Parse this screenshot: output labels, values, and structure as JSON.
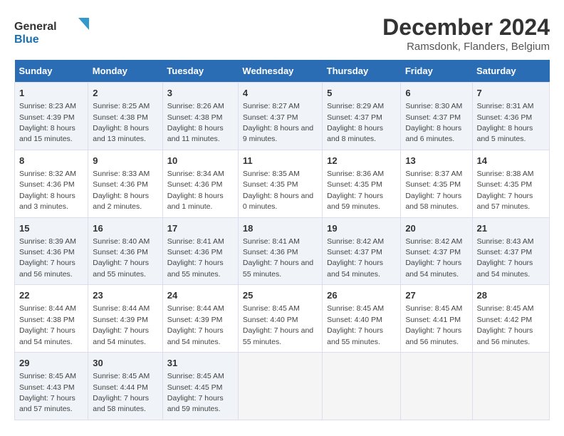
{
  "logo": {
    "line1": "General",
    "line2": "Blue"
  },
  "title": "December 2024",
  "subtitle": "Ramsdonk, Flanders, Belgium",
  "days_of_week": [
    "Sunday",
    "Monday",
    "Tuesday",
    "Wednesday",
    "Thursday",
    "Friday",
    "Saturday"
  ],
  "weeks": [
    [
      {
        "day": "1",
        "sunrise": "8:23 AM",
        "sunset": "4:39 PM",
        "daylight": "8 hours and 15 minutes."
      },
      {
        "day": "2",
        "sunrise": "8:25 AM",
        "sunset": "4:38 PM",
        "daylight": "8 hours and 13 minutes."
      },
      {
        "day": "3",
        "sunrise": "8:26 AM",
        "sunset": "4:38 PM",
        "daylight": "8 hours and 11 minutes."
      },
      {
        "day": "4",
        "sunrise": "8:27 AM",
        "sunset": "4:37 PM",
        "daylight": "8 hours and 9 minutes."
      },
      {
        "day": "5",
        "sunrise": "8:29 AM",
        "sunset": "4:37 PM",
        "daylight": "8 hours and 8 minutes."
      },
      {
        "day": "6",
        "sunrise": "8:30 AM",
        "sunset": "4:37 PM",
        "daylight": "8 hours and 6 minutes."
      },
      {
        "day": "7",
        "sunrise": "8:31 AM",
        "sunset": "4:36 PM",
        "daylight": "8 hours and 5 minutes."
      }
    ],
    [
      {
        "day": "8",
        "sunrise": "8:32 AM",
        "sunset": "4:36 PM",
        "daylight": "8 hours and 3 minutes."
      },
      {
        "day": "9",
        "sunrise": "8:33 AM",
        "sunset": "4:36 PM",
        "daylight": "8 hours and 2 minutes."
      },
      {
        "day": "10",
        "sunrise": "8:34 AM",
        "sunset": "4:36 PM",
        "daylight": "8 hours and 1 minute."
      },
      {
        "day": "11",
        "sunrise": "8:35 AM",
        "sunset": "4:35 PM",
        "daylight": "8 hours and 0 minutes."
      },
      {
        "day": "12",
        "sunrise": "8:36 AM",
        "sunset": "4:35 PM",
        "daylight": "7 hours and 59 minutes."
      },
      {
        "day": "13",
        "sunrise": "8:37 AM",
        "sunset": "4:35 PM",
        "daylight": "7 hours and 58 minutes."
      },
      {
        "day": "14",
        "sunrise": "8:38 AM",
        "sunset": "4:35 PM",
        "daylight": "7 hours and 57 minutes."
      }
    ],
    [
      {
        "day": "15",
        "sunrise": "8:39 AM",
        "sunset": "4:36 PM",
        "daylight": "7 hours and 56 minutes."
      },
      {
        "day": "16",
        "sunrise": "8:40 AM",
        "sunset": "4:36 PM",
        "daylight": "7 hours and 55 minutes."
      },
      {
        "day": "17",
        "sunrise": "8:41 AM",
        "sunset": "4:36 PM",
        "daylight": "7 hours and 55 minutes."
      },
      {
        "day": "18",
        "sunrise": "8:41 AM",
        "sunset": "4:36 PM",
        "daylight": "7 hours and 55 minutes."
      },
      {
        "day": "19",
        "sunrise": "8:42 AM",
        "sunset": "4:37 PM",
        "daylight": "7 hours and 54 minutes."
      },
      {
        "day": "20",
        "sunrise": "8:42 AM",
        "sunset": "4:37 PM",
        "daylight": "7 hours and 54 minutes."
      },
      {
        "day": "21",
        "sunrise": "8:43 AM",
        "sunset": "4:37 PM",
        "daylight": "7 hours and 54 minutes."
      }
    ],
    [
      {
        "day": "22",
        "sunrise": "8:44 AM",
        "sunset": "4:38 PM",
        "daylight": "7 hours and 54 minutes."
      },
      {
        "day": "23",
        "sunrise": "8:44 AM",
        "sunset": "4:39 PM",
        "daylight": "7 hours and 54 minutes."
      },
      {
        "day": "24",
        "sunrise": "8:44 AM",
        "sunset": "4:39 PM",
        "daylight": "7 hours and 54 minutes."
      },
      {
        "day": "25",
        "sunrise": "8:45 AM",
        "sunset": "4:40 PM",
        "daylight": "7 hours and 55 minutes."
      },
      {
        "day": "26",
        "sunrise": "8:45 AM",
        "sunset": "4:40 PM",
        "daylight": "7 hours and 55 minutes."
      },
      {
        "day": "27",
        "sunrise": "8:45 AM",
        "sunset": "4:41 PM",
        "daylight": "7 hours and 56 minutes."
      },
      {
        "day": "28",
        "sunrise": "8:45 AM",
        "sunset": "4:42 PM",
        "daylight": "7 hours and 56 minutes."
      }
    ],
    [
      {
        "day": "29",
        "sunrise": "8:45 AM",
        "sunset": "4:43 PM",
        "daylight": "7 hours and 57 minutes."
      },
      {
        "day": "30",
        "sunrise": "8:45 AM",
        "sunset": "4:44 PM",
        "daylight": "7 hours and 58 minutes."
      },
      {
        "day": "31",
        "sunrise": "8:45 AM",
        "sunset": "4:45 PM",
        "daylight": "7 hours and 59 minutes."
      },
      null,
      null,
      null,
      null
    ]
  ],
  "labels": {
    "sunrise": "Sunrise: ",
    "sunset": "Sunset: ",
    "daylight": "Daylight: "
  }
}
